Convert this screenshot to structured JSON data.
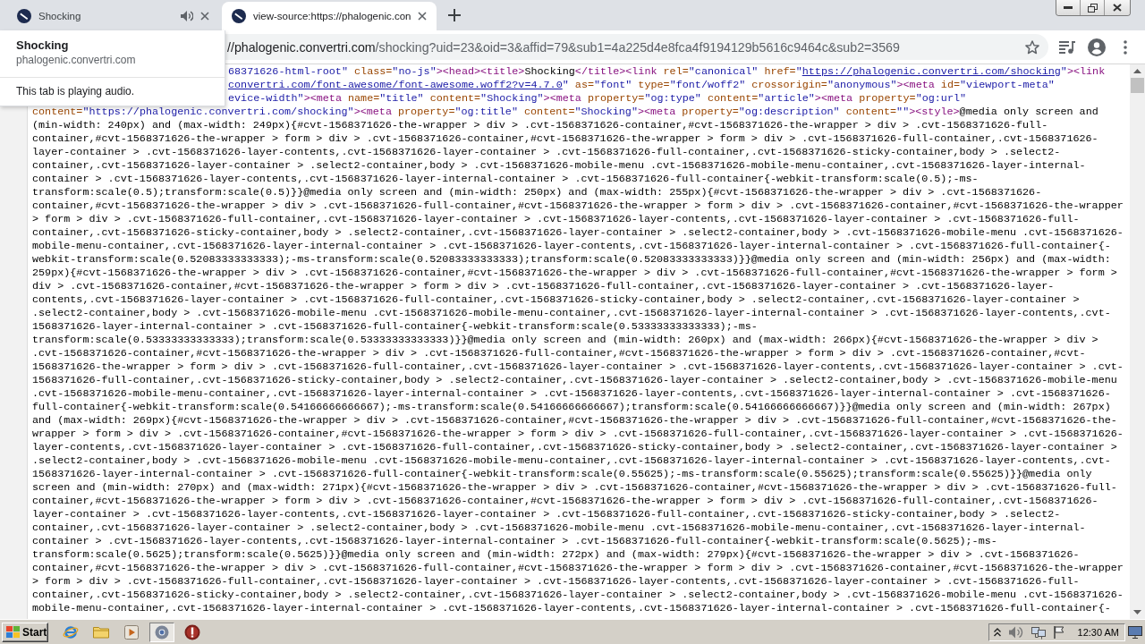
{
  "tabs": [
    {
      "title": "Shocking",
      "selected": false,
      "playing_audio": true
    },
    {
      "title": "view-source:https://phalogenic.con",
      "selected": true,
      "playing_audio": false
    }
  ],
  "hover_card": {
    "title": "Shocking",
    "domain": "phalogenic.convertri.com",
    "status": "This tab is playing audio."
  },
  "address_bar": {
    "host": "//phalogenic.convertri.com",
    "path": "/shocking?uid=23&oid=3&affid=79&sub1=4a225d4e8fca4f9194129b5616c9464c&sub2=3569"
  },
  "source_view": {
    "lines_beside_card": [
      {
        "segments": [
          {
            "kind": "value",
            "text": "68371626-html-root\""
          },
          {
            "kind": "attr",
            "text": " class="
          },
          {
            "kind": "value",
            "text": "\"no-js\""
          },
          {
            "kind": "tag",
            "text": "><head><title>"
          },
          {
            "kind": "text",
            "text": "Shocking"
          },
          {
            "kind": "tag",
            "text": "</title><link"
          },
          {
            "kind": "attr",
            "text": " rel="
          },
          {
            "kind": "value",
            "text": "\"canonical\""
          },
          {
            "kind": "attr",
            "text": " href="
          },
          {
            "kind": "value",
            "text": "\""
          },
          {
            "kind": "link",
            "text": "https://phalogenic.convertri.com/shocking"
          },
          {
            "kind": "value",
            "text": "\""
          },
          {
            "kind": "tag",
            "text": "><link"
          }
        ]
      },
      {
        "segments": [
          {
            "kind": "link",
            "text": "convertri.com/font-awesome/font-awesome.woff2?v=4.7.0"
          },
          {
            "kind": "value",
            "text": "\""
          },
          {
            "kind": "attr",
            "text": " as="
          },
          {
            "kind": "value",
            "text": "\"font\""
          },
          {
            "kind": "attr",
            "text": " type="
          },
          {
            "kind": "value",
            "text": "\"font/woff2\""
          },
          {
            "kind": "attr",
            "text": " crossorigin="
          },
          {
            "kind": "value",
            "text": "\"anonymous\""
          },
          {
            "kind": "tag",
            "text": "><meta"
          },
          {
            "kind": "attr",
            "text": " id="
          },
          {
            "kind": "value",
            "text": "\"viewport-meta\""
          }
        ]
      },
      {
        "segments": [
          {
            "kind": "value",
            "text": "evice-width\""
          },
          {
            "kind": "tag",
            "text": "><meta"
          },
          {
            "kind": "attr",
            "text": " name="
          },
          {
            "kind": "value",
            "text": "\"title\""
          },
          {
            "kind": "attr",
            "text": " content="
          },
          {
            "kind": "value",
            "text": "\"Shocking\""
          },
          {
            "kind": "tag",
            "text": "><meta"
          },
          {
            "kind": "attr",
            "text": " property="
          },
          {
            "kind": "value",
            "text": "\"og:type\""
          },
          {
            "kind": "attr",
            "text": " content="
          },
          {
            "kind": "value",
            "text": "\"article\""
          },
          {
            "kind": "tag",
            "text": "><meta"
          },
          {
            "kind": "attr",
            "text": " property="
          },
          {
            "kind": "value",
            "text": "\"og:url\""
          }
        ]
      }
    ],
    "lines": [
      {
        "segments": [
          {
            "kind": "attr",
            "text": "content="
          },
          {
            "kind": "value",
            "text": "\"https://phalogenic.convertri.com/shocking\""
          },
          {
            "kind": "tag",
            "text": "><meta"
          },
          {
            "kind": "attr",
            "text": " property="
          },
          {
            "kind": "value",
            "text": "\"og:title\""
          },
          {
            "kind": "attr",
            "text": " content="
          },
          {
            "kind": "value",
            "text": "\"Shocking\""
          },
          {
            "kind": "tag",
            "text": "><meta"
          },
          {
            "kind": "attr",
            "text": " property="
          },
          {
            "kind": "value",
            "text": "\"og:description\""
          },
          {
            "kind": "attr",
            "text": " content="
          },
          {
            "kind": "value",
            "text": "\"\""
          },
          {
            "kind": "tag",
            "text": "><style>"
          },
          {
            "kind": "text",
            "text": "@media only screen and"
          }
        ]
      },
      {
        "text": "(min-width: 240px) and (max-width: 249px){#cvt-1568371626-the-wrapper > div > .cvt-1568371626-container,#cvt-1568371626-the-wrapper > div > .cvt-1568371626-full-"
      },
      {
        "text": "container,#cvt-1568371626-the-wrapper > form > div > .cvt-1568371626-container,#cvt-1568371626-the-wrapper > form > div > .cvt-1568371626-full-container,.cvt-1568371626-"
      },
      {
        "text": "layer-container > .cvt-1568371626-layer-contents,.cvt-1568371626-layer-container > .cvt-1568371626-full-container,.cvt-1568371626-sticky-container,body > .select2-"
      },
      {
        "text": "container,.cvt-1568371626-layer-container > .select2-container,body > .cvt-1568371626-mobile-menu .cvt-1568371626-mobile-menu-container,.cvt-1568371626-layer-internal-"
      },
      {
        "text": "container > .cvt-1568371626-layer-contents,.cvt-1568371626-layer-internal-container > .cvt-1568371626-full-container{-webkit-transform:scale(0.5);-ms-"
      },
      {
        "text": "transform:scale(0.5);transform:scale(0.5)}}@media only screen and (min-width: 250px) and (max-width: 255px){#cvt-1568371626-the-wrapper > div > .cvt-1568371626-"
      },
      {
        "text": "container,#cvt-1568371626-the-wrapper > div > .cvt-1568371626-full-container,#cvt-1568371626-the-wrapper > form > div > .cvt-1568371626-container,#cvt-1568371626-the-wrapper"
      },
      {
        "text": "> form > div > .cvt-1568371626-full-container,.cvt-1568371626-layer-container > .cvt-1568371626-layer-contents,.cvt-1568371626-layer-container > .cvt-1568371626-full-"
      },
      {
        "text": "container,.cvt-1568371626-sticky-container,body > .select2-container,.cvt-1568371626-layer-container > .select2-container,body > .cvt-1568371626-mobile-menu .cvt-1568371626-"
      },
      {
        "text": "mobile-menu-container,.cvt-1568371626-layer-internal-container > .cvt-1568371626-layer-contents,.cvt-1568371626-layer-internal-container > .cvt-1568371626-full-container{-"
      },
      {
        "text": "webkit-transform:scale(0.52083333333333);-ms-transform:scale(0.52083333333333);transform:scale(0.52083333333333)}}@media only screen and (min-width: 256px) and (max-width:"
      },
      {
        "text": "259px){#cvt-1568371626-the-wrapper > div > .cvt-1568371626-container,#cvt-1568371626-the-wrapper > div > .cvt-1568371626-full-container,#cvt-1568371626-the-wrapper > form >"
      },
      {
        "text": "div > .cvt-1568371626-container,#cvt-1568371626-the-wrapper > form > div > .cvt-1568371626-full-container,.cvt-1568371626-layer-container > .cvt-1568371626-layer-"
      },
      {
        "text": "contents,.cvt-1568371626-layer-container > .cvt-1568371626-full-container,.cvt-1568371626-sticky-container,body > .select2-container,.cvt-1568371626-layer-container >"
      },
      {
        "text": ".select2-container,body > .cvt-1568371626-mobile-menu .cvt-1568371626-mobile-menu-container,.cvt-1568371626-layer-internal-container > .cvt-1568371626-layer-contents,.cvt-"
      },
      {
        "text": "1568371626-layer-internal-container > .cvt-1568371626-full-container{-webkit-transform:scale(0.53333333333333);-ms-"
      },
      {
        "text": "transform:scale(0.53333333333333);transform:scale(0.53333333333333)}}@media only screen and (min-width: 260px) and (max-width: 266px){#cvt-1568371626-the-wrapper > div >"
      },
      {
        "text": ".cvt-1568371626-container,#cvt-1568371626-the-wrapper > div > .cvt-1568371626-full-container,#cvt-1568371626-the-wrapper > form > div > .cvt-1568371626-container,#cvt-"
      },
      {
        "text": "1568371626-the-wrapper > form > div > .cvt-1568371626-full-container,.cvt-1568371626-layer-container > .cvt-1568371626-layer-contents,.cvt-1568371626-layer-container > .cvt-"
      },
      {
        "text": "1568371626-full-container,.cvt-1568371626-sticky-container,body > .select2-container,.cvt-1568371626-layer-container > .select2-container,body > .cvt-1568371626-mobile-menu"
      },
      {
        "text": ".cvt-1568371626-mobile-menu-container,.cvt-1568371626-layer-internal-container > .cvt-1568371626-layer-contents,.cvt-1568371626-layer-internal-container > .cvt-1568371626-"
      },
      {
        "text": "full-container{-webkit-transform:scale(0.54166666666667);-ms-transform:scale(0.54166666666667);transform:scale(0.54166666666667)}}@media only screen and (min-width: 267px)"
      },
      {
        "text": "and (max-width: 269px){#cvt-1568371626-the-wrapper > div > .cvt-1568371626-container,#cvt-1568371626-the-wrapper > div > .cvt-1568371626-full-container,#cvt-1568371626-the-"
      },
      {
        "text": "wrapper > form > div > .cvt-1568371626-container,#cvt-1568371626-the-wrapper > form > div > .cvt-1568371626-full-container,.cvt-1568371626-layer-container > .cvt-1568371626-"
      },
      {
        "text": "layer-contents,.cvt-1568371626-layer-container > .cvt-1568371626-full-container,.cvt-1568371626-sticky-container,body > .select2-container,.cvt-1568371626-layer-container >"
      },
      {
        "text": ".select2-container,body > .cvt-1568371626-mobile-menu .cvt-1568371626-mobile-menu-container,.cvt-1568371626-layer-internal-container > .cvt-1568371626-layer-contents,.cvt-"
      },
      {
        "text": "1568371626-layer-internal-container > .cvt-1568371626-full-container{-webkit-transform:scale(0.55625);-ms-transform:scale(0.55625);transform:scale(0.55625)}}@media only"
      },
      {
        "text": "screen and (min-width: 270px) and (max-width: 271px){#cvt-1568371626-the-wrapper > div > .cvt-1568371626-container,#cvt-1568371626-the-wrapper > div > .cvt-1568371626-full-"
      },
      {
        "text": "container,#cvt-1568371626-the-wrapper > form > div > .cvt-1568371626-container,#cvt-1568371626-the-wrapper > form > div > .cvt-1568371626-full-container,.cvt-1568371626-"
      },
      {
        "text": "layer-container > .cvt-1568371626-layer-contents,.cvt-1568371626-layer-container > .cvt-1568371626-full-container,.cvt-1568371626-sticky-container,body > .select2-"
      },
      {
        "text": "container,.cvt-1568371626-layer-container > .select2-container,body > .cvt-1568371626-mobile-menu .cvt-1568371626-mobile-menu-container,.cvt-1568371626-layer-internal-"
      },
      {
        "text": "container > .cvt-1568371626-layer-contents,.cvt-1568371626-layer-internal-container > .cvt-1568371626-full-container{-webkit-transform:scale(0.5625);-ms-"
      },
      {
        "text": "transform:scale(0.5625);transform:scale(0.5625)}}@media only screen and (min-width: 272px) and (max-width: 279px){#cvt-1568371626-the-wrapper > div > .cvt-1568371626-"
      },
      {
        "text": "container,#cvt-1568371626-the-wrapper > div > .cvt-1568371626-full-container,#cvt-1568371626-the-wrapper > form > div > .cvt-1568371626-container,#cvt-1568371626-the-wrapper"
      },
      {
        "text": "> form > div > .cvt-1568371626-full-container,.cvt-1568371626-layer-container > .cvt-1568371626-layer-contents,.cvt-1568371626-layer-container > .cvt-1568371626-full-"
      },
      {
        "text": "container,.cvt-1568371626-sticky-container,body > .select2-container,.cvt-1568371626-layer-container > .select2-container,body > .cvt-1568371626-mobile-menu .cvt-1568371626-"
      },
      {
        "text": "mobile-menu-container,.cvt-1568371626-layer-internal-container > .cvt-1568371626-layer-contents,.cvt-1568371626-layer-internal-container > .cvt-1568371626-full-container{-"
      }
    ]
  },
  "taskbar": {
    "start": "Start",
    "buttons": [
      {
        "kind": "web",
        "selected": false
      },
      {
        "kind": "folder",
        "selected": false
      },
      {
        "kind": "media",
        "selected": false
      },
      {
        "kind": "browser",
        "selected": true
      },
      {
        "kind": "alert",
        "selected": false
      }
    ],
    "clock": "12:30 AM"
  }
}
